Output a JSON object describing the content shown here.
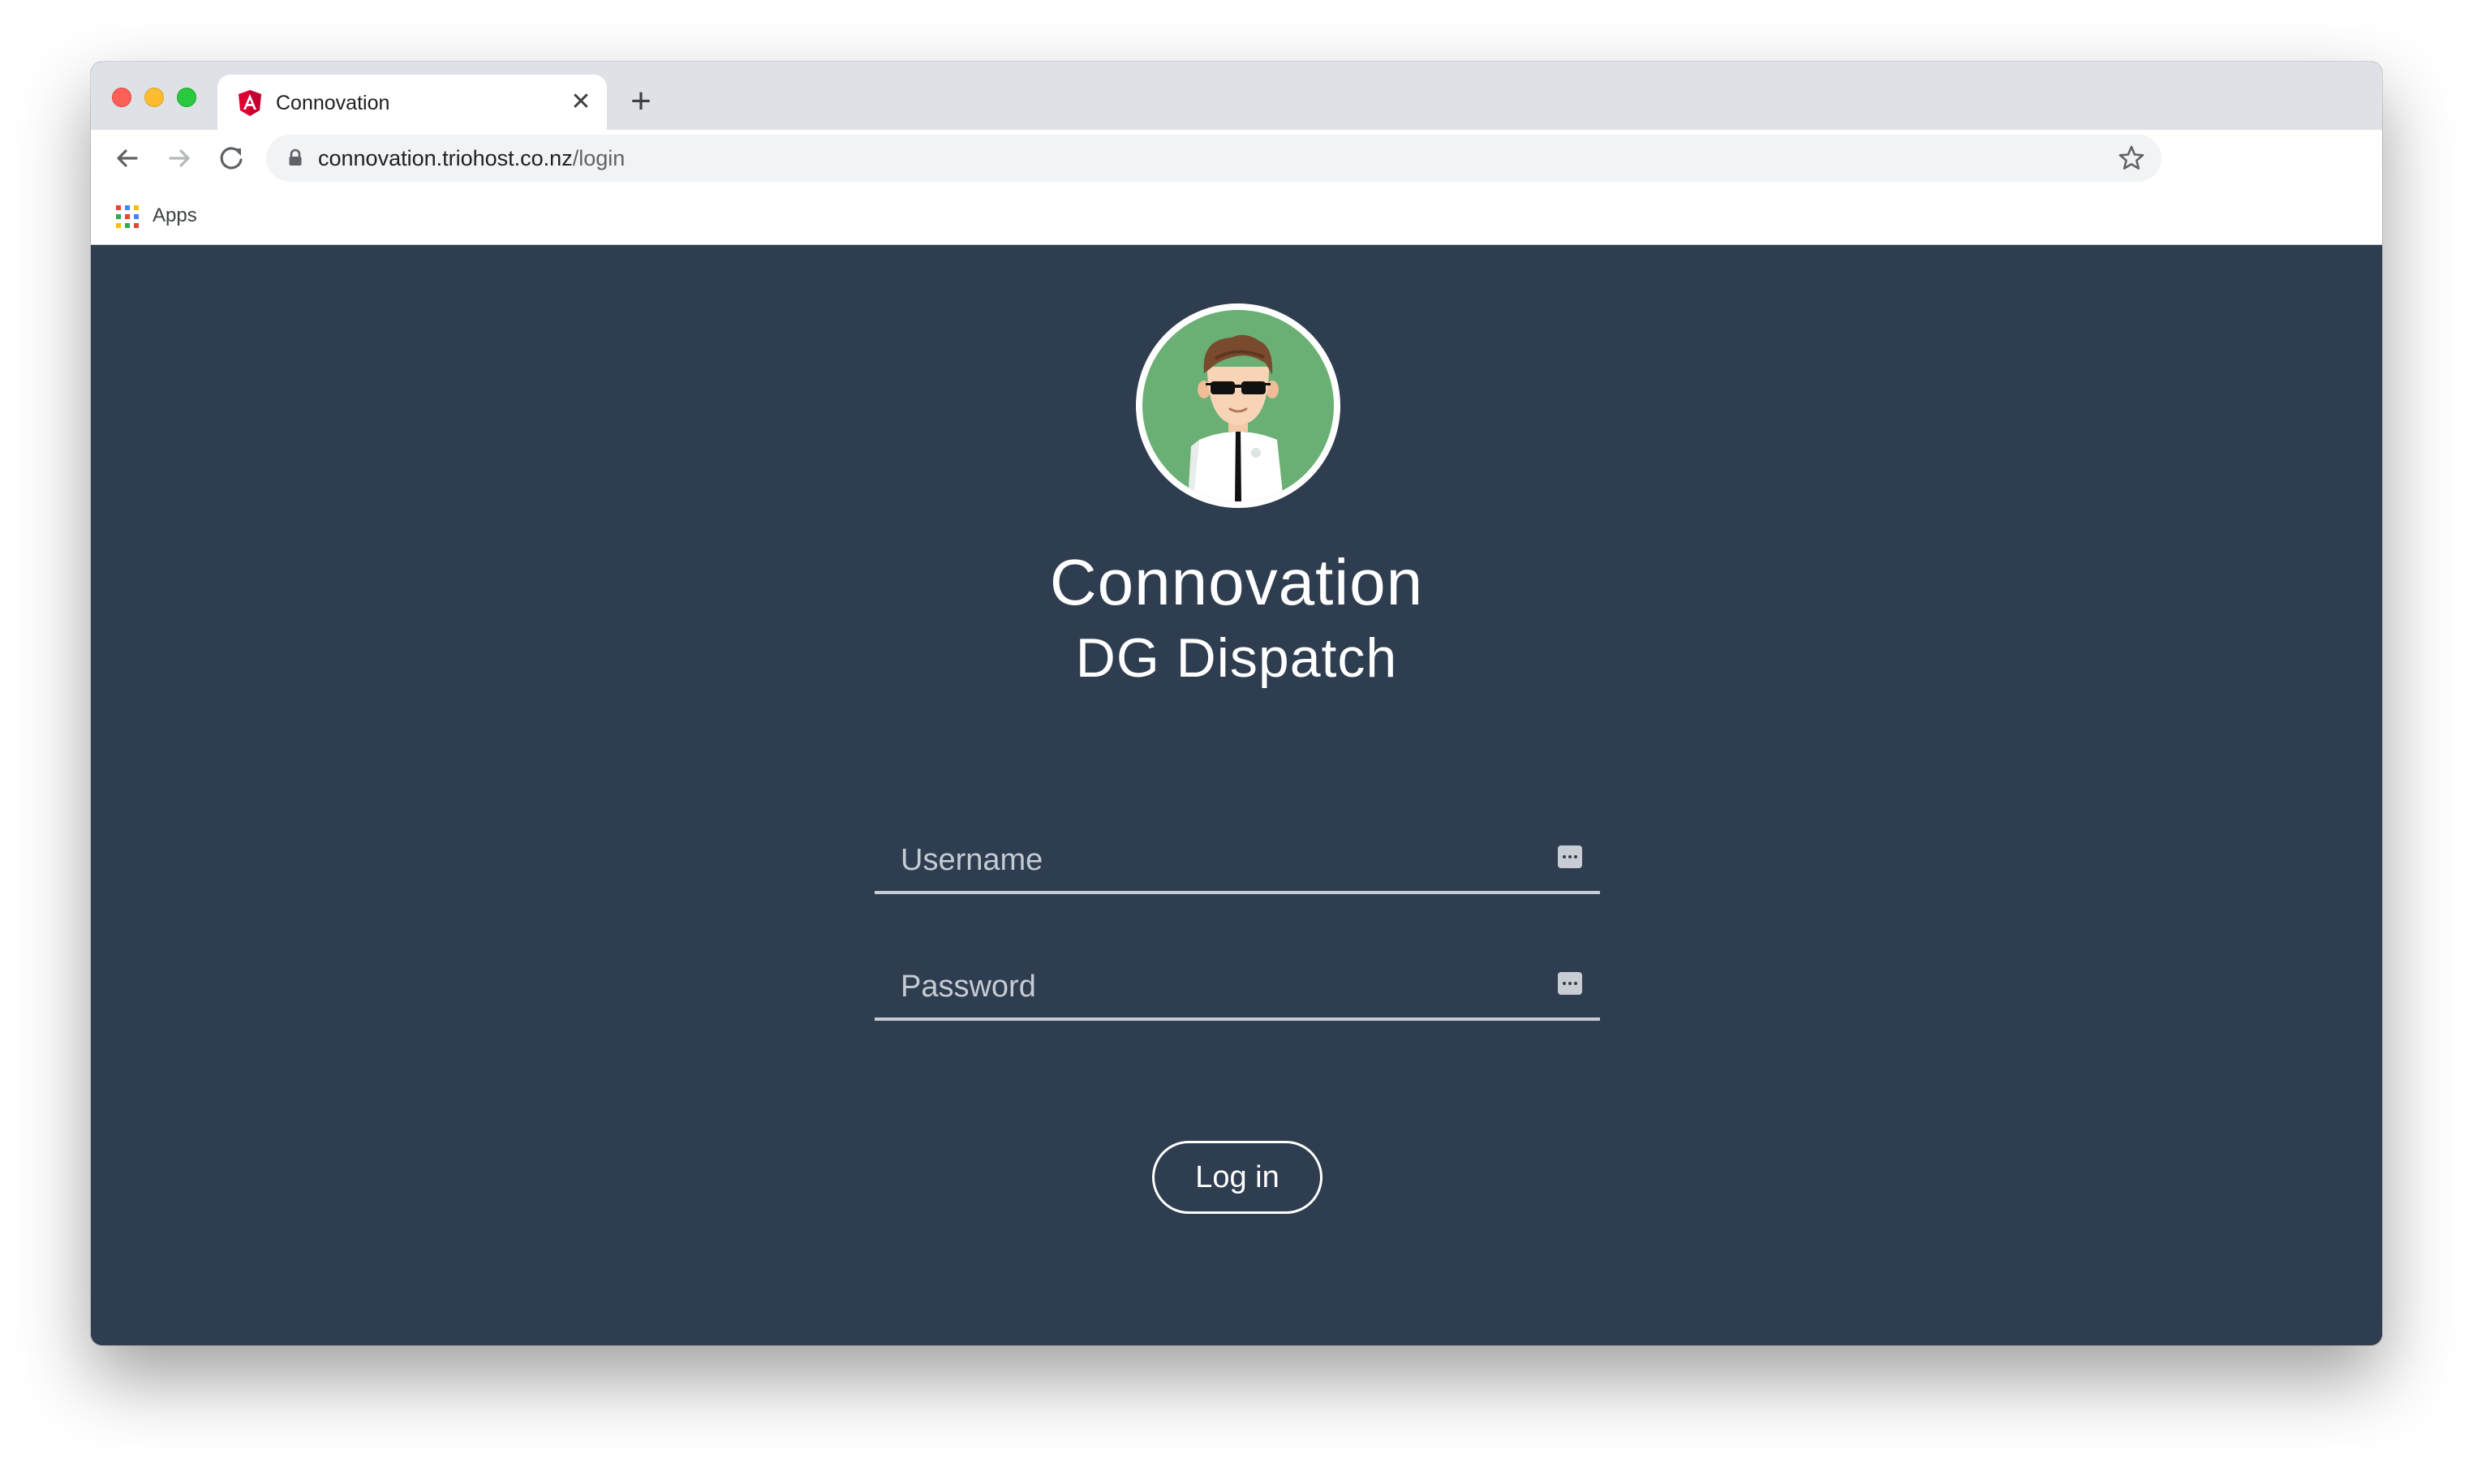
{
  "browser": {
    "tab": {
      "title": "Connovation",
      "favicon": "angular-logo-icon",
      "close_glyph": "✕"
    },
    "new_tab_glyph": "+",
    "address_bar": {
      "host": "connovation.triohost.co.nz",
      "path": "/login"
    },
    "bookmarks": {
      "apps_label": "Apps"
    }
  },
  "login": {
    "title": "Connovation",
    "subtitle": "DG Dispatch",
    "username_placeholder": "Username",
    "password_placeholder": "Password",
    "login_button": "Log in"
  },
  "colors": {
    "page_background": "#2e3d50",
    "avatar_background": "#6ab075",
    "favicon_red": "#dd0031"
  }
}
